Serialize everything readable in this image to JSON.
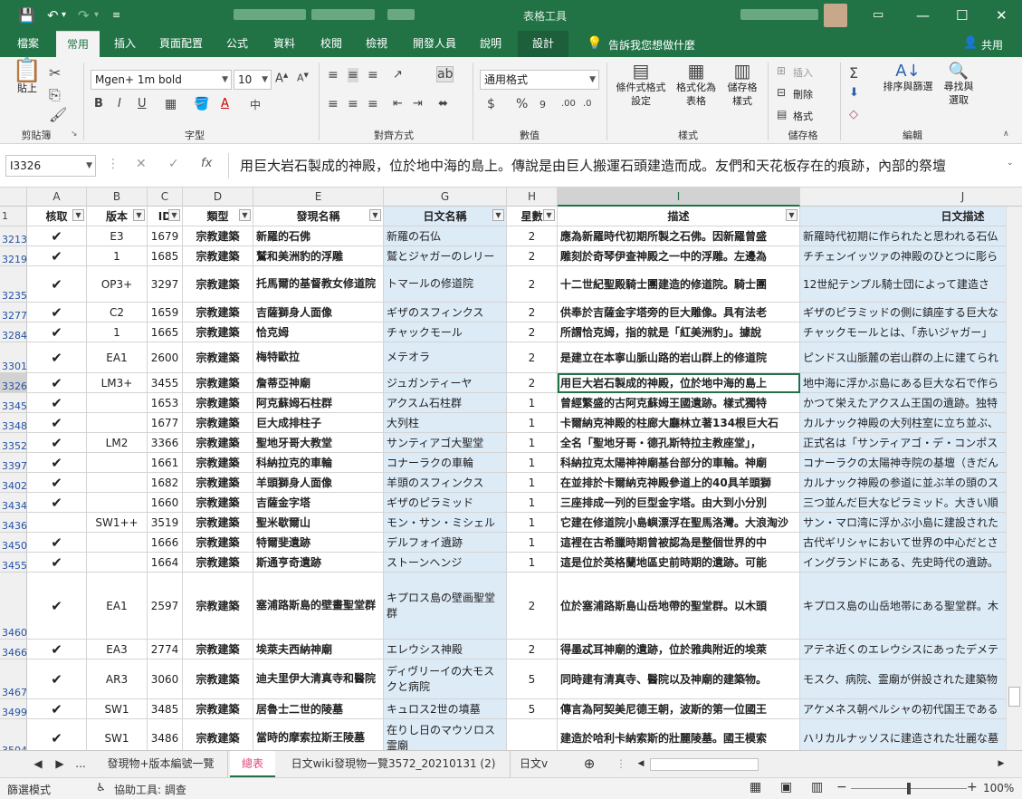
{
  "window": {
    "context_tool": "表格工具",
    "share_label": "共用"
  },
  "tabs": [
    "檔案",
    "常用",
    "插入",
    "頁面配置",
    "公式",
    "資料",
    "校閱",
    "檢視",
    "開發人員",
    "說明",
    "設計"
  ],
  "tell_me": "告訴我您想做什麼",
  "ribbon": {
    "paste": "貼上",
    "clipboard": "剪貼簿",
    "font_name": "Mgen+ 1m bold",
    "font_size": "10",
    "font_group": "字型",
    "align_group": "對齊方式",
    "number_format": "通用格式",
    "number_group": "數值",
    "cond_format": [
      "條件式格式",
      "設定"
    ],
    "format_table": [
      "格式化為",
      "表格"
    ],
    "cell_styles": [
      "儲存格",
      "樣式"
    ],
    "styles_group": "樣式",
    "insert": "插入",
    "delete": "刪除",
    "format": "格式",
    "cells_group": "儲存格",
    "sort_filter": [
      "排序與篩選",
      ""
    ],
    "find_select": [
      "尋找與",
      "選取"
    ],
    "editing_group": "編輯"
  },
  "formula_bar": {
    "name_box": "I3326",
    "fx": "fx",
    "value": "用巨大岩石製成的神殿，位於地中海的島上。傳說是由巨人搬運石頭建造而成。友們和天花板存在的痕跡，內部的祭壇"
  },
  "columns": [
    {
      "letter": "A",
      "header": "核取"
    },
    {
      "letter": "B",
      "header": "版本"
    },
    {
      "letter": "C",
      "header": "ID"
    },
    {
      "letter": "D",
      "header": "類型"
    },
    {
      "letter": "E",
      "header": "發現名稱"
    },
    {
      "letter": "G",
      "header": "日文名稱"
    },
    {
      "letter": "H",
      "header": "星數"
    },
    {
      "letter": "I",
      "header": "描述"
    },
    {
      "letter": "J",
      "header": "日文描述"
    }
  ],
  "header_row_num": "1",
  "rows": [
    {
      "n": "3213",
      "a": "✔",
      "b": "E3",
      "c": "1679",
      "d": "宗教建築",
      "e": "新羅的石佛",
      "g": "新羅の石仏",
      "h": "2",
      "i": "應為新羅時代初期所製之石佛。因新羅曾盛",
      "j": "新羅時代初期に作られたと思われる石仏"
    },
    {
      "n": "3219",
      "a": "✔",
      "b": "1",
      "c": "1685",
      "d": "宗教建築",
      "e": "鷲和美洲豹的浮雕",
      "g": "鷲とジャガーのレリー",
      "h": "2",
      "i": "雕刻於奇琴伊查神殿之一中的浮雕。左邊為",
      "j": "チチェンイッツァの神殿のひとつに彫ら"
    },
    {
      "n": "3235",
      "a": "✔",
      "b": "OP3+",
      "c": "3297",
      "d": "宗教建築",
      "e": "托馬爾的基督教女修道院",
      "g": "トマールの修道院",
      "h": "2",
      "i": "十二世紀聖殿騎士團建造的修道院。騎士團",
      "j": "12世紀テンプル騎士団によって建造さ"
    },
    {
      "n": "3277",
      "a": "✔",
      "b": "C2",
      "c": "1659",
      "d": "宗教建築",
      "e": "吉薩獅身人面像",
      "g": "ギザのスフィンクス",
      "h": "2",
      "i": "供奉於吉薩金字塔旁的巨大雕像。具有法老",
      "j": "ギザのピラミッドの側に鎮座する巨大な"
    },
    {
      "n": "3284",
      "a": "✔",
      "b": "1",
      "c": "1665",
      "d": "宗教建築",
      "e": "恰克姆",
      "g": "チャックモール",
      "h": "2",
      "i": "所謂恰克姆，指的就是「紅美洲豹」。據說",
      "j": "チャックモールとは、「赤いジャガー」"
    },
    {
      "n": "3301",
      "a": "✔",
      "b": "EA1",
      "c": "2600",
      "d": "宗教建築",
      "e": "梅特歐拉",
      "g": "メテオラ",
      "h": "2",
      "i": "是建立在本寧山脈山路的岩山群上的修道院",
      "j": "ピンドス山脈麓の岩山群の上に建てられ"
    },
    {
      "n": "3326",
      "a": "✔",
      "b": "LM3+",
      "c": "3455",
      "d": "宗教建築",
      "e": "詹蒂亞神廟",
      "g": "ジュガンティーヤ",
      "h": "2",
      "i": "用巨大岩石製成的神殿，位於地中海的島上",
      "j": "地中海に浮かぶ島にある巨大な石で作ら"
    },
    {
      "n": "3345",
      "a": "✔",
      "b": "",
      "c": "1653",
      "d": "宗教建築",
      "e": "阿克蘇姆石柱群",
      "g": "アクスム石柱群",
      "h": "1",
      "i": "曾經繁盛的古阿克蘇姆王國遺跡。樣式獨特",
      "j": "かつて栄えたアクスム王国の遺跡。独特"
    },
    {
      "n": "3348",
      "a": "✔",
      "b": "",
      "c": "1677",
      "d": "宗教建築",
      "e": "巨大成排柱子",
      "g": "大列柱",
      "h": "1",
      "i": "卡爾納克神殿的柱廊大廳林立著134根巨大石",
      "j": "カルナック神殿の大列柱室に立ち並ぶ、"
    },
    {
      "n": "3352",
      "a": "✔",
      "b": "LM2",
      "c": "3366",
      "d": "宗教建築",
      "e": "聖地牙哥大教堂",
      "g": "サンティアゴ大聖堂",
      "h": "1",
      "i": "全名「聖地牙哥・德孔斯特拉主教座堂」，",
      "j": "正式名は「サンティアゴ・デ・コンポス"
    },
    {
      "n": "3397",
      "a": "✔",
      "b": "",
      "c": "1661",
      "d": "宗教建築",
      "e": "科納拉克的車輪",
      "g": "コナーラクの車輪",
      "h": "1",
      "i": "科納拉克太陽神神廟基台部分的車輪。神廟",
      "j": "コナーラクの太陽神寺院の基壇（きだん"
    },
    {
      "n": "3402",
      "a": "✔",
      "b": "",
      "c": "1682",
      "d": "宗教建築",
      "e": "羊頭獅身人面像",
      "g": "羊頭のスフィンクス",
      "h": "1",
      "i": "在並排於卡爾納克神殿參道上的40具羊頭獅",
      "j": "カルナック神殿の参道に並ぶ羊の頭のス"
    },
    {
      "n": "3434",
      "a": "✔",
      "b": "",
      "c": "1660",
      "d": "宗教建築",
      "e": "吉薩金字塔",
      "g": "ギザのピラミッド",
      "h": "1",
      "i": "三座排成一列的巨型金字塔。由大到小分別",
      "j": "三つ並んだ巨大なピラミッド。大きい順"
    },
    {
      "n": "3436",
      "a": "",
      "b": "SW1++",
      "c": "3519",
      "d": "宗教建築",
      "e": "聖米歇爾山",
      "g": "モン・サン・ミシェル",
      "h": "1",
      "i": "它建在修道院小島嶼漂浮在聖馬洛灣。大浪淘沙",
      "j": "サン・マロ湾に浮かぶ小島に建設された"
    },
    {
      "n": "3450",
      "a": "✔",
      "b": "",
      "c": "1666",
      "d": "宗教建築",
      "e": "特爾斐遺跡",
      "g": "デルフォイ遺跡",
      "h": "1",
      "i": "這裡在古希臘時期曾被認為是整個世界的中",
      "j": "古代ギリシャにおいて世界の中心だとさ"
    },
    {
      "n": "3455",
      "a": "✔",
      "b": "",
      "c": "1664",
      "d": "宗教建築",
      "e": "斯通亨奇遺跡",
      "g": "ストーンヘンジ",
      "h": "1",
      "i": "這是位於英格蘭地區史前時期的遺跡。可能",
      "j": "イングランドにある、先史時代の遺跡。"
    },
    {
      "n": "3460",
      "a": "✔",
      "b": "EA1",
      "c": "2597",
      "d": "宗教建築",
      "e": "塞浦路斯島的壁畫聖堂群",
      "g": "キプロス島の壁画聖堂群",
      "h": "2",
      "i": "位於塞浦路斯島山岳地帶的聖堂群。以木頭",
      "j": "キプロス島の山岳地帯にある聖堂群。木"
    },
    {
      "n": "3466",
      "a": "✔",
      "b": "EA3",
      "c": "2774",
      "d": "宗教建築",
      "e": "埃萊夫西納神廟",
      "g": "エレウシス神殿",
      "h": "2",
      "i": "得墨忒耳神廟的遺跡，位於雅典附近的埃萊",
      "j": "アテネ近くのエレウシスにあったデメテ"
    },
    {
      "n": "3467",
      "a": "✔",
      "b": "AR3",
      "c": "3060",
      "d": "宗教建築",
      "e": "迪夫里伊大清真寺和醫院",
      "g": "ディヴリーイの大モスクと病院",
      "h": "5",
      "i": "同時建有清真寺、醫院以及神廟的建築物。",
      "j": "モスク、病院、霊廟が併設された建築物"
    },
    {
      "n": "3499",
      "a": "✔",
      "b": "SW1",
      "c": "3485",
      "d": "宗教建築",
      "e": "居魯士二世的陵墓",
      "g": "キュロス2世の墳墓",
      "h": "5",
      "i": "傳言為阿契美尼德王朝，波斯的第一位國王",
      "j": "アケメネス朝ペルシャの初代国王である"
    },
    {
      "n": "3504",
      "a": "✔",
      "b": "SW1",
      "c": "3486",
      "d": "宗教建築",
      "e": "當時的摩索拉斯王陵墓",
      "g": "在りし日のマウソロス霊廟",
      "h": "",
      "i": "建造於哈利卡納索斯的壯麗陵墓。國王模索",
      "j": "ハリカルナッソスに建造された壮麗な墓"
    }
  ],
  "sheets": [
    "發現物+版本編號一覽",
    "總表",
    "日文wiki發現物一覽3572_20210131 (2)",
    "日文v"
  ],
  "sheet_nav": [
    "◀",
    "▶",
    "..."
  ],
  "status": {
    "mode": "篩選模式",
    "accessibility": "協助工具: 調查",
    "zoom": "100%"
  }
}
